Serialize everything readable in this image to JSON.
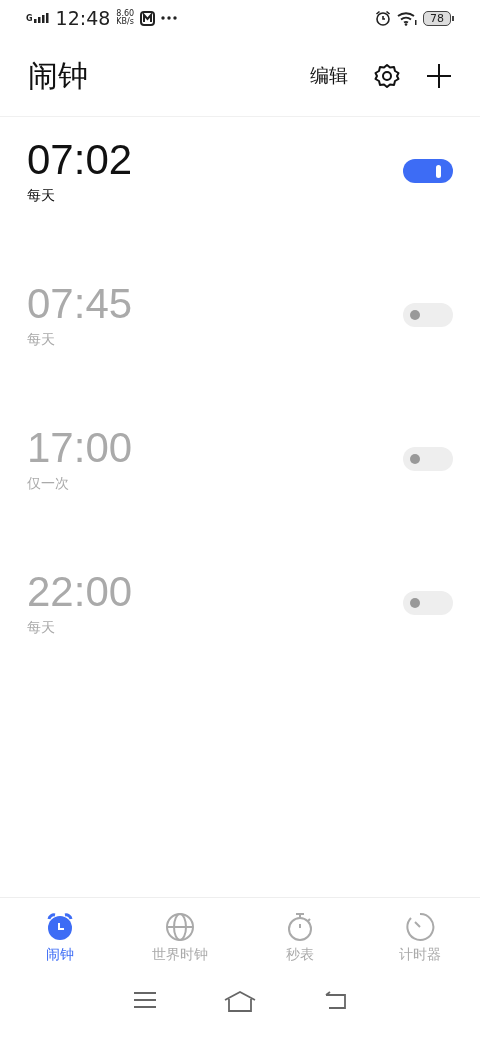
{
  "status_bar": {
    "network": "G",
    "time": "12:48",
    "speed": "8.60",
    "speed_unit": "KB/s",
    "battery": "78"
  },
  "header": {
    "title": "闹钟",
    "edit": "编辑"
  },
  "alarms": [
    {
      "time": "07:02",
      "repeat": "每天",
      "on": true
    },
    {
      "time": "07:45",
      "repeat": "每天",
      "on": false
    },
    {
      "time": "17:00",
      "repeat": "仅一次",
      "on": false
    },
    {
      "time": "22:00",
      "repeat": "每天",
      "on": false
    }
  ],
  "tabs": [
    {
      "label": "闹钟",
      "kind": "alarm",
      "selected": true
    },
    {
      "label": "世界时钟",
      "kind": "globe",
      "selected": false
    },
    {
      "label": "秒表",
      "kind": "stopwatch",
      "selected": false
    },
    {
      "label": "计时器",
      "kind": "timer",
      "selected": false
    }
  ]
}
